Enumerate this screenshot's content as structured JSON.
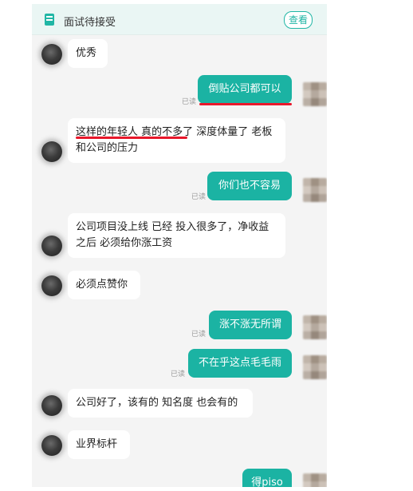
{
  "header": {
    "title": "面试待接受",
    "view_button": "查看",
    "icon": "document-icon"
  },
  "messages": [
    {
      "side": "left",
      "text": "优秀"
    },
    {
      "side": "right",
      "text": "倒贴公司都可以",
      "status": "已读"
    },
    {
      "side": "left",
      "text_line1": "这样的年轻人 真的不多了 深度体量了 老板",
      "text_line2": "和公司的压力"
    },
    {
      "side": "right",
      "text": "你们也不容易",
      "status": "已读"
    },
    {
      "side": "left",
      "text_line1": "公司项目没上线 已经 投入很多了，净收益",
      "text_line2": "之后 必须给你涨工资"
    },
    {
      "side": "left",
      "text": "必须点赞你"
    },
    {
      "side": "right",
      "text": "涨不涨无所谓",
      "status": "已读"
    },
    {
      "side": "right",
      "text": "不在乎这点毛毛雨",
      "status": "已读"
    },
    {
      "side": "left",
      "text": "公司好了，该有的 知名度 也会有的"
    },
    {
      "side": "left",
      "text": "业界标杆"
    },
    {
      "side": "right",
      "text": "得piso"
    }
  ],
  "colors": {
    "accent": "#1bb3a3",
    "highlight": "#e8182b"
  }
}
